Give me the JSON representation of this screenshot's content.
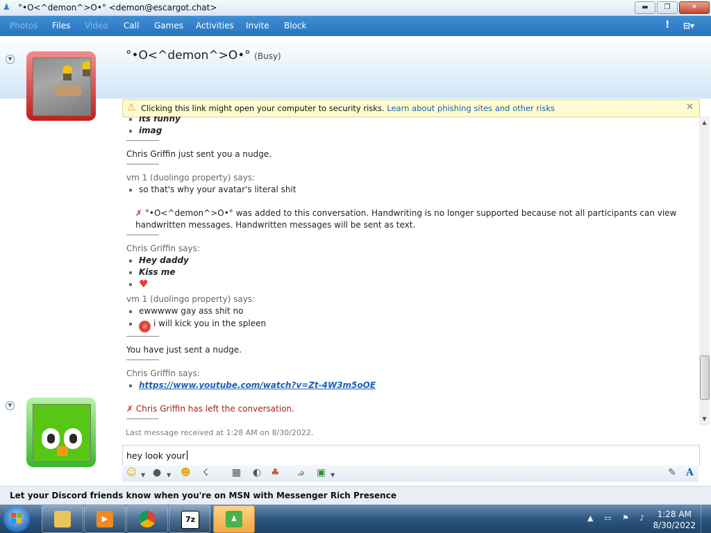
{
  "window": {
    "title": "°•O<^demon^>O•° <demon@escargot.chat>",
    "minimize": "▬",
    "maximize": "❐",
    "close": "✕"
  },
  "toolbar": {
    "photos": "Photos",
    "files": "Files",
    "video": "Video",
    "call": "Call",
    "games": "Games",
    "activities": "Activities",
    "invite": "Invite",
    "block": "Block",
    "alert_glyph": "!",
    "menu_glyph": "⊟▾"
  },
  "contact": {
    "name": "°•O<^demon^>O•°",
    "status": "(Busy)"
  },
  "warning": {
    "text": "Clicking this link might open your computer to security risks.",
    "link": "Learn about phishing sites and other risks"
  },
  "conversation": {
    "partial_1": "its funny",
    "partial_2": "imag",
    "nudge_received": "Chris Griffin just sent you a nudge.",
    "vm_says_1": "vm 1 (duolingo property) says:",
    "vm_msg_1": "so that's why your avatar's literal shit",
    "system_line1": "°•O<^demon^>O•° was added to this conversation. Handwriting is no longer supported because not all participants can view",
    "system_line2": "handwritten messages. Handwritten messages will be sent as text.",
    "chris_says_1": "Chris Griffin says:",
    "chris_msg_1": "Hey daddy",
    "chris_msg_2": "Kiss me",
    "vm_says_2": "vm 1 (duolingo property) says:",
    "vm_msg_2": "ewwwww gay ass shit no",
    "vm_msg_3": "i will kick you in the spleen",
    "nudge_sent": "You have just sent a nudge.",
    "chris_says_2": "Chris Griffin says:",
    "chris_link": "https://www.youtube.com/watch?v=Zt-4W3m5oOE",
    "left": "Chris Griffin has left the conversation."
  },
  "last_message": "Last message received at 1:28 AM on 8/30/2022.",
  "input": {
    "value": "hey look your"
  },
  "format_bar": {
    "font_glyph": "A"
  },
  "promo": "Let your Discord friends know when you're on MSN with Messenger Rich Presence",
  "taskbar": {
    "winrar_label": "7z"
  },
  "clock": {
    "time": "1:28 AM",
    "date": "8/30/2022"
  },
  "colors": {
    "toolbar": "#2f7dc8",
    "busy_frame": "#c01e1e",
    "online_frame": "#39b82c",
    "link": "#1a5fb4"
  }
}
